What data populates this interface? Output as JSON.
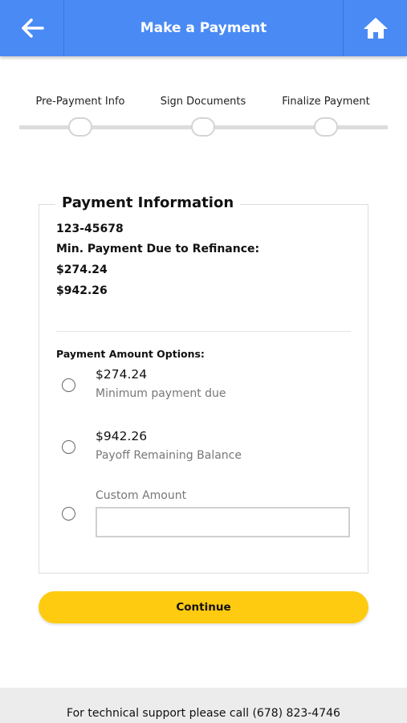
{
  "header": {
    "title": "Make a Payment",
    "back_icon": "arrow-left-icon",
    "home_icon": "home-icon",
    "bg_color": "#4a8af4"
  },
  "steps": [
    {
      "label": "Pre-Payment Info"
    },
    {
      "label": "Sign Documents"
    },
    {
      "label": "Finalize Payment"
    }
  ],
  "card": {
    "title": "Payment Information",
    "account_number": "123-45678",
    "min_payment_label": "Min. Payment Due to Refinance:",
    "min_payment_value": "$274.24",
    "balance_value": "$942.26",
    "options_heading": "Payment Amount Options:",
    "options": [
      {
        "amount": "$274.24",
        "description": "Minimum payment due"
      },
      {
        "amount": "$942.26",
        "description": "Payoff Remaining Balance"
      }
    ],
    "custom_label": "Custom Amount",
    "custom_value": ""
  },
  "continue_label": "Continue",
  "accent_color": "#fecb11",
  "footer": {
    "support_text": "For technical support please call (678) 823-4746"
  }
}
